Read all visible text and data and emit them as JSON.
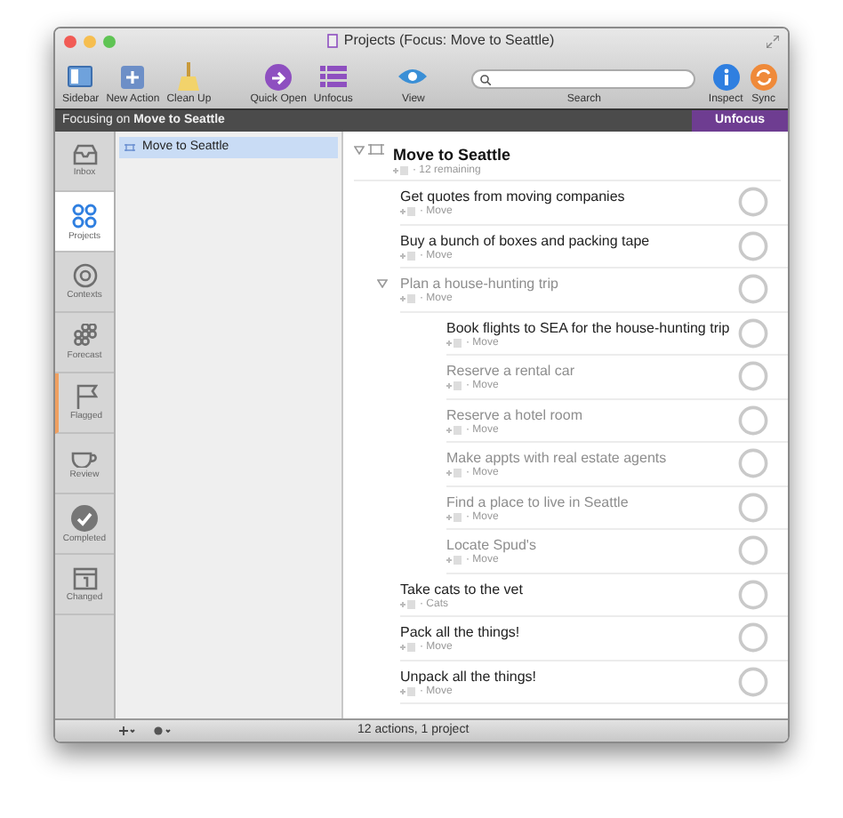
{
  "window": {
    "title": "Projects (Focus: Move to Seattle)"
  },
  "toolbar": [
    {
      "kind": "sidebar",
      "label": "Sidebar"
    },
    {
      "kind": "new",
      "label": "New Action"
    },
    {
      "kind": "cleanup",
      "label": "Clean Up"
    },
    {
      "kind": "quickopen",
      "label": "Quick Open"
    },
    {
      "kind": "unfocus",
      "label": "Unfocus"
    },
    {
      "kind": "view",
      "label": "View"
    },
    {
      "kind": "search",
      "label": "Search"
    },
    {
      "kind": "inspect",
      "label": "Inspect"
    },
    {
      "kind": "sync",
      "label": "Sync"
    }
  ],
  "focus_bar": {
    "prefix": "Focusing on",
    "project": "Move to Seattle",
    "button": "Unfocus"
  },
  "perspectives": [
    {
      "kind": "inbox",
      "label": "Inbox",
      "selected": false
    },
    {
      "kind": "projects",
      "label": "Projects",
      "selected": true
    },
    {
      "kind": "contexts",
      "label": "Contexts",
      "selected": false
    },
    {
      "kind": "forecast",
      "label": "Forecast",
      "selected": false
    },
    {
      "kind": "flagged",
      "label": "Flagged",
      "selected": false
    },
    {
      "kind": "review",
      "label": "Review",
      "selected": false
    },
    {
      "kind": "completed",
      "label": "Completed",
      "selected": false
    },
    {
      "kind": "changed",
      "label": "Changed",
      "selected": false
    }
  ],
  "sidebar": {
    "items": [
      {
        "label": "Move to Seattle",
        "selected": true
      }
    ]
  },
  "outline": {
    "project": {
      "title": "Move to Seattle",
      "meta": "· 12 remaining",
      "expanded": true
    },
    "tasks": [
      {
        "title": "Get quotes from moving companies",
        "meta": "· Move",
        "dimmed": false
      },
      {
        "title": "Buy a bunch of boxes and packing tape",
        "meta": "· Move",
        "dimmed": false
      },
      {
        "title": "Plan a house-hunting trip",
        "meta": "· Move",
        "dimmed": true,
        "expanded": true,
        "children": [
          {
            "title": "Book flights to SEA for the house-hunting trip",
            "meta": "· Move",
            "dimmed": false
          },
          {
            "title": "Reserve a rental car",
            "meta": "· Move",
            "dimmed": true
          },
          {
            "title": "Reserve a hotel room",
            "meta": "· Move",
            "dimmed": true
          },
          {
            "title": "Make appts with real estate agents",
            "meta": "· Move",
            "dimmed": true
          },
          {
            "title": "Find a place to live in Seattle",
            "meta": "· Move",
            "dimmed": true
          },
          {
            "title": "Locate Spud's",
            "meta": "· Move",
            "dimmed": true
          }
        ]
      },
      {
        "title": "Take cats to the vet",
        "meta": "· Cats",
        "dimmed": false
      },
      {
        "title": "Pack all the things!",
        "meta": "· Move",
        "dimmed": false
      },
      {
        "title": "Unpack all the things!",
        "meta": "· Move",
        "dimmed": false
      }
    ]
  },
  "status_bar": {
    "text": "12 actions, 1 project"
  }
}
